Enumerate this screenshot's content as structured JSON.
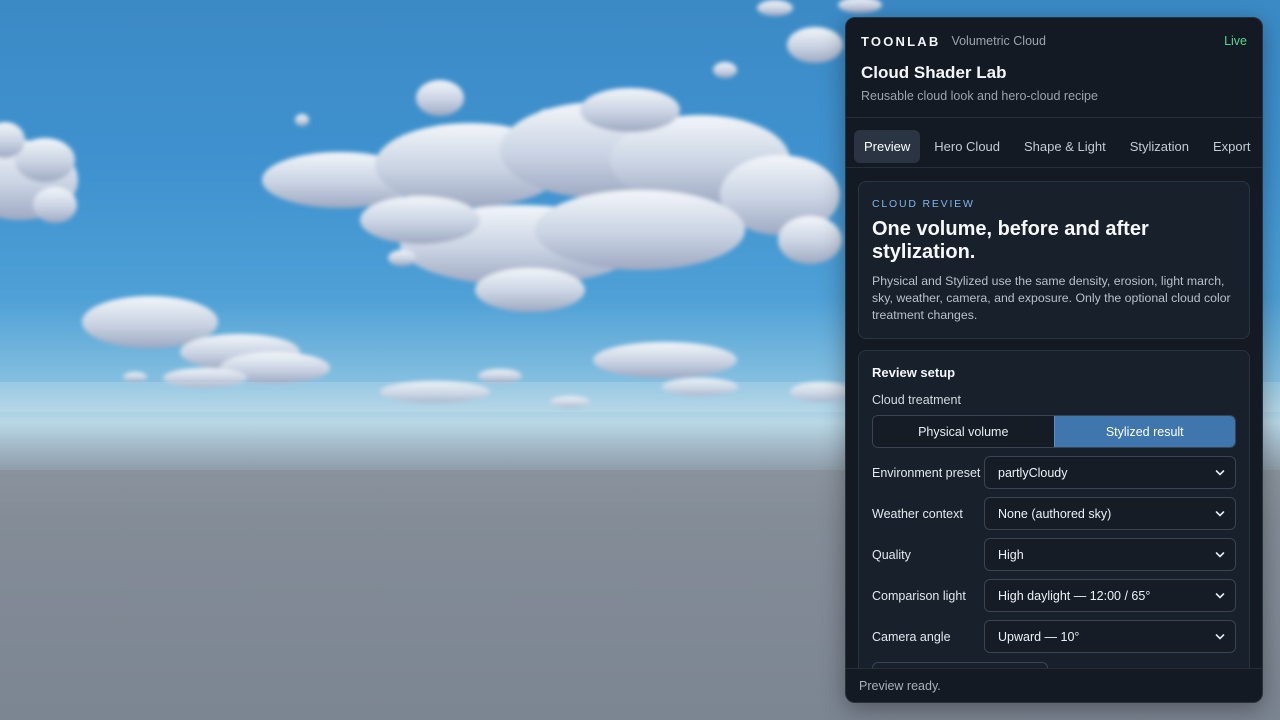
{
  "header": {
    "brand": "TOONLAB",
    "brand_sub": "Volumetric Cloud",
    "status": "Live",
    "title": "Cloud Shader Lab",
    "subtitle": "Reusable cloud look and hero-cloud recipe"
  },
  "tabs": [
    {
      "label": "Preview",
      "active": true
    },
    {
      "label": "Hero Cloud",
      "active": false
    },
    {
      "label": "Shape & Light",
      "active": false
    },
    {
      "label": "Stylization",
      "active": false
    },
    {
      "label": "Export",
      "active": false
    }
  ],
  "review": {
    "eyebrow": "CLOUD REVIEW",
    "heading": "One volume, before and after stylization.",
    "description": "Physical and Stylized use the same density, erosion, light march, sky, weather, camera, and exposure. Only the optional cloud color treatment changes."
  },
  "setup": {
    "title": "Review setup",
    "treatment_label": "Cloud treatment",
    "treatment_options": [
      "Physical volume",
      "Stylized result"
    ],
    "treatment_selected": "Stylized result",
    "fields": [
      {
        "label": "Environment preset",
        "value": "partlyCloudy"
      },
      {
        "label": "Weather context",
        "value": "None (authored sky)"
      },
      {
        "label": "Quality",
        "value": "High"
      },
      {
        "label": "Comparison light",
        "value": "High daylight — 12:00 / 65°"
      },
      {
        "label": "Camera angle",
        "value": "Upward — 10°"
      }
    ]
  },
  "status_bar": "Preview ready.",
  "colors": {
    "panel_bg": "#131a24",
    "accent": "#3e76ad",
    "live": "#58d68d",
    "eyebrow": "#7fb6e6"
  }
}
